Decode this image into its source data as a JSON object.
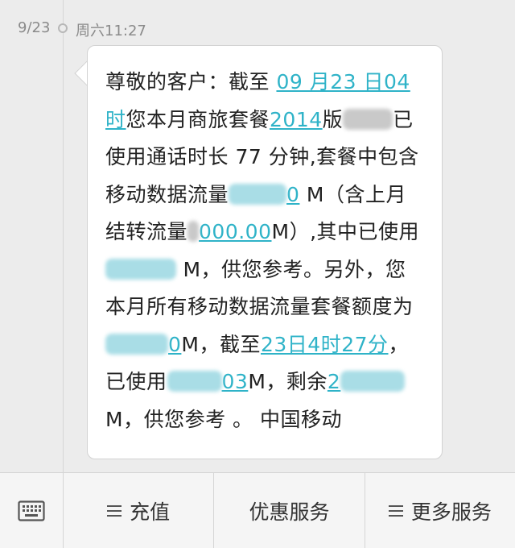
{
  "timestamp": {
    "date": "9/23",
    "time": "周六11:27"
  },
  "message": {
    "parts": [
      "尊敬的客户：截至 ",
      "09 月23 日04时",
      "您本月商旅套餐",
      "2014",
      "版",
      "已使用通话时长 77 分钟,套餐中包含移动数据流量",
      "0",
      " M（含上月结转流量",
      "000.00",
      "M）,其中已使用",
      " M，供您参考。另外，您本月所有移动数据流量套餐额度为",
      "0",
      "M，截至",
      "23日4时27分",
      "，已使用",
      "03",
      "M，剩余",
      "2",
      "M，供您参考 。 中国移动"
    ]
  },
  "bottom_bar": {
    "recharge": "充值",
    "promotions": "优惠服务",
    "more": "更多服务"
  },
  "colors": {
    "link": "#2fb3c8",
    "bubble_bg": "#ffffff",
    "page_bg": "#ececec",
    "bar_bg": "#f5f5f5"
  },
  "icons": [
    "keyboard-icon",
    "menu-icon"
  ]
}
